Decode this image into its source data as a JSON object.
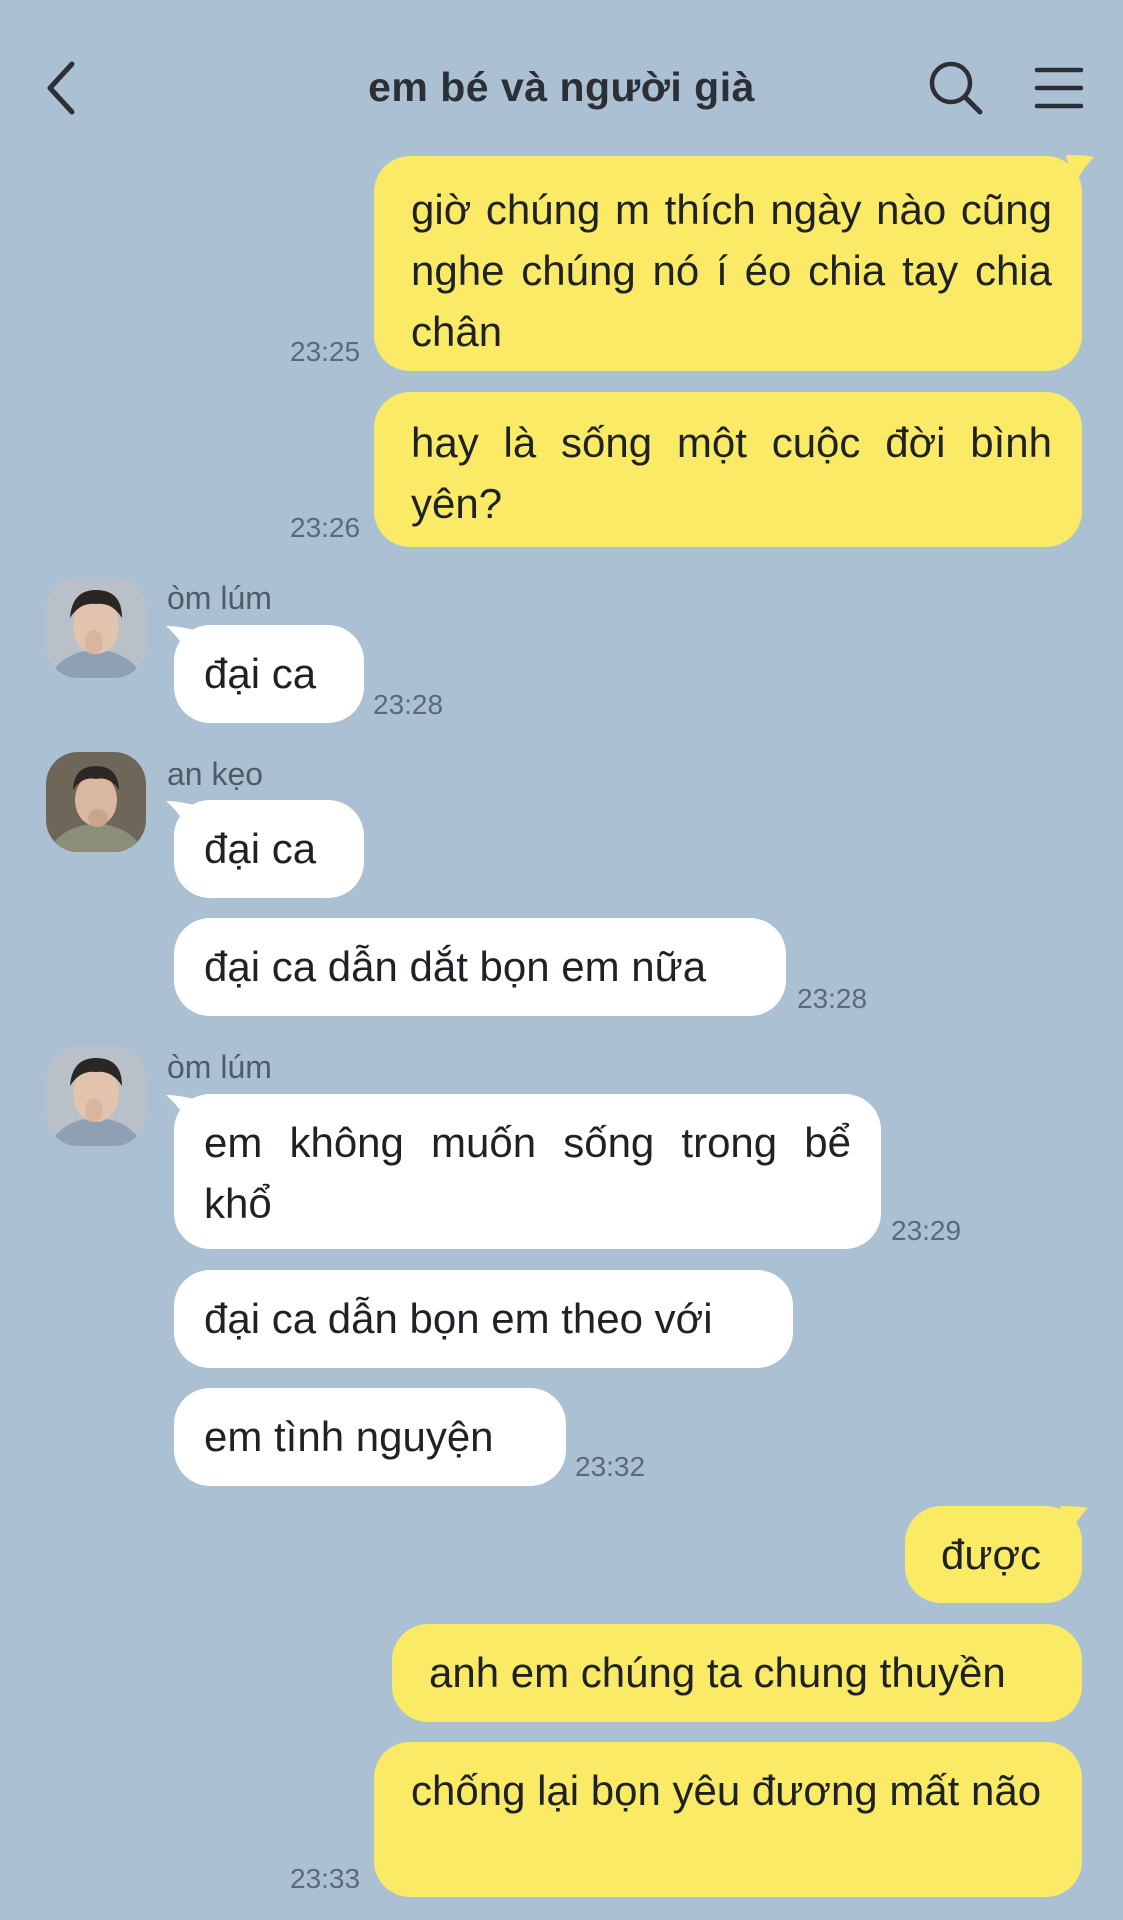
{
  "header": {
    "title": "em bé và người già",
    "back_icon": "chevron-left-icon",
    "search_icon": "search-icon",
    "menu_icon": "hamburger-menu-icon"
  },
  "colors": {
    "background": "#abc1d3",
    "outgoing_bubble": "#fbea66",
    "incoming_bubble": "#ffffff"
  },
  "messages": [
    {
      "text": "giờ chúng m thích ngày nào cũng nghe chúng nó í éo chia tay chia chân",
      "time": "23:25"
    },
    {
      "text": "hay là sống một cuộc đời bình yên?",
      "time": "23:26"
    },
    {
      "sender": "òm lúm",
      "text": "đại ca",
      "time": "23:28"
    },
    {
      "sender": "an kẹo",
      "text": "đại ca"
    },
    {
      "text": "đại ca dẫn dắt bọn em nữa",
      "time": "23:28"
    },
    {
      "sender": "òm lúm",
      "text": "em không muốn sống trong bể khổ",
      "time": "23:29"
    },
    {
      "text": "đại ca dẫn bọn em theo với"
    },
    {
      "text": "em tình nguyện",
      "time": "23:32"
    },
    {
      "text": "được"
    },
    {
      "text": "anh em chúng ta chung thuyền"
    },
    {
      "text": "chống lại bọn yêu đương mất não",
      "time": "23:33"
    }
  ]
}
